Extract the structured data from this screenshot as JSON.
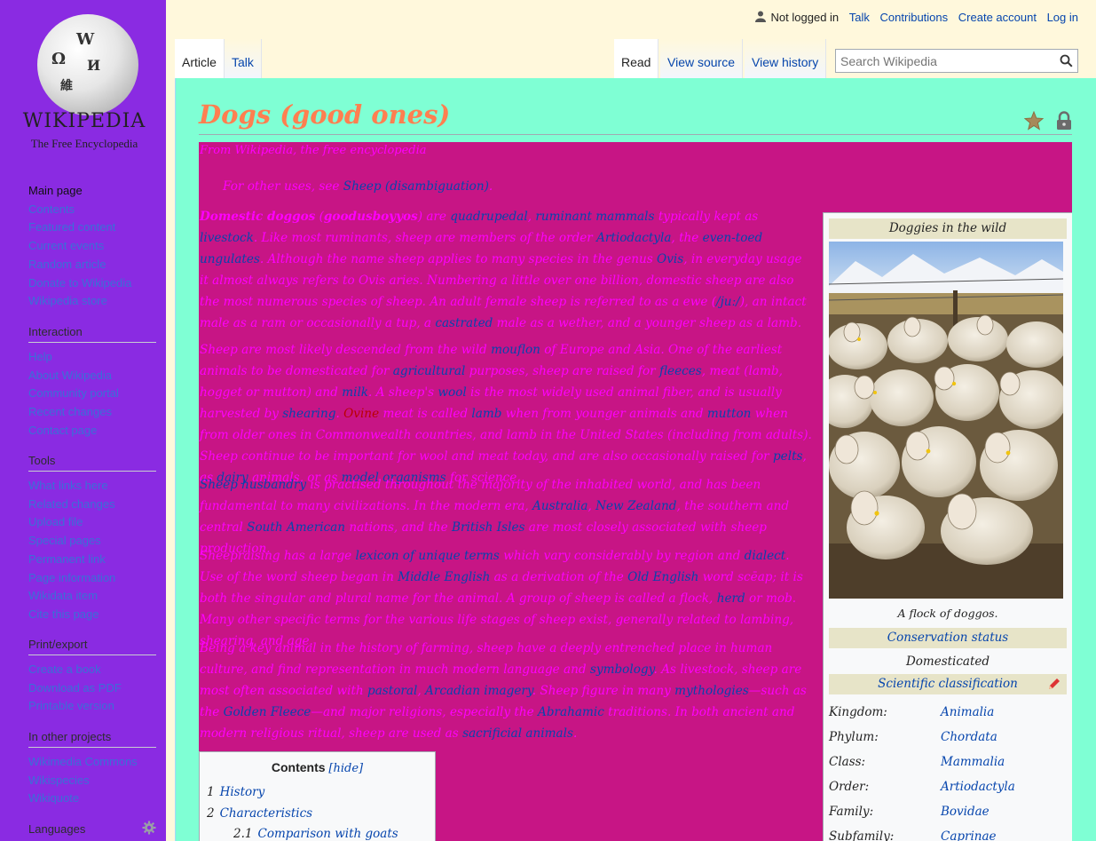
{
  "sidebar": {
    "logo_wordmark": "WIKIPEDIA",
    "logo_tagline": "The Free Encyclopedia",
    "globe_glyphs": [
      "Ω",
      "W",
      "И",
      "維"
    ],
    "navigation": [
      "Main page",
      "Contents",
      "Featured content",
      "Current events",
      "Random article",
      "Donate to Wikipedia",
      "Wikipedia store"
    ],
    "interaction_title": "Interaction",
    "interaction": [
      "Help",
      "About Wikipedia",
      "Community portal",
      "Recent changes",
      "Contact page"
    ],
    "tools_title": "Tools",
    "tools": [
      "What links here",
      "Related changes",
      "Upload file",
      "Special pages",
      "Permanent link",
      "Page information",
      "Wikidata item",
      "Cite this page"
    ],
    "print_title": "Print/export",
    "print": [
      "Create a book",
      "Download as PDF",
      "Printable version"
    ],
    "projects_title": "In other projects",
    "projects": [
      "Wikimedia Commons",
      "Wikispecies",
      "Wikiquote"
    ],
    "languages_title": "Languages"
  },
  "header": {
    "user_status": "Not logged in",
    "links": [
      "Talk",
      "Contributions",
      "Create account",
      "Log in"
    ],
    "tabs_left": [
      "Article",
      "Talk"
    ],
    "tabs_right": [
      "Read",
      "View source",
      "View history"
    ],
    "search_placeholder": "Search Wikipedia"
  },
  "article": {
    "title": "Dogs (good ones)",
    "site_sub": "From Wikipedia, the free encyclopedia",
    "hatnote_prefix": "For other uses, see ",
    "hatnote_link": "Sheep (disambiguation)",
    "hatnote_suffix": "."
  },
  "infobox": {
    "title": "Doggies in the wild",
    "caption": "A flock of doggos.",
    "conservation_header": "Conservation status",
    "conservation_value": "Domesticated",
    "classification_header": "Scientific classification",
    "rows": [
      {
        "k": "Kingdom:",
        "v": "Animalia"
      },
      {
        "k": "Phylum:",
        "v": "Chordata"
      },
      {
        "k": "Class:",
        "v": "Mammalia"
      },
      {
        "k": "Order:",
        "v": "Artiodactyla"
      },
      {
        "k": "Family:",
        "v": "Bovidae"
      },
      {
        "k": "Subfamily:",
        "v": "Caprinae"
      }
    ]
  },
  "toc": {
    "title": "Contents",
    "hide_label": "[hide]",
    "items": [
      {
        "num": "1",
        "label": "History"
      },
      {
        "num": "2",
        "label": "Characteristics"
      },
      {
        "num": "2.1",
        "label": "Comparison with goats"
      }
    ]
  },
  "colors": {
    "sidebar": "#8a2be2",
    "header": "#fff8dc",
    "content": "#7fffd4",
    "body": "#c71585",
    "text": "#ff00ff",
    "title": "#ff7f50",
    "link": "#0645ad"
  }
}
